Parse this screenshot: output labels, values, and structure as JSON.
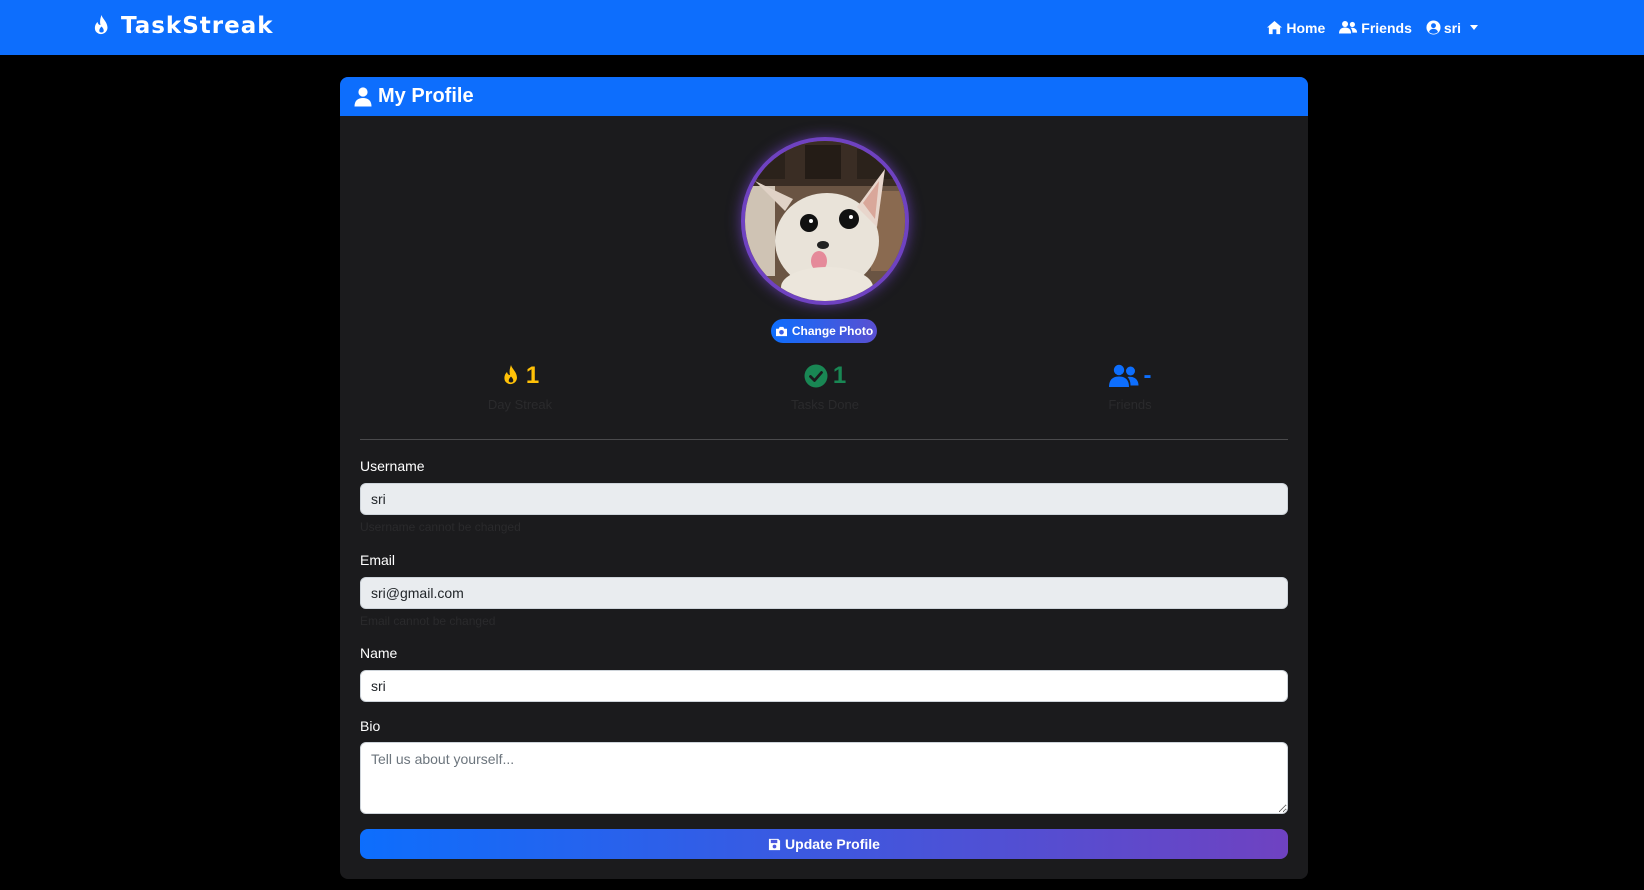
{
  "navbar": {
    "brand": "TaskStreak",
    "home_label": "Home",
    "friends_label": "Friends",
    "user_label": "sri",
    "brand_icon": "fire-icon",
    "home_icon": "house-icon",
    "friends_icon": "users-icon",
    "user_icon": "user-circle-icon"
  },
  "profile": {
    "header_title": "My Profile",
    "header_icon": "user-icon",
    "avatar_alt": "Profile photo of a chihuahua",
    "change_photo_label": "Change Photo",
    "change_photo_icon": "camera-icon"
  },
  "stats": [
    {
      "value": "1",
      "label": "Day Streak",
      "icon": "fire-icon",
      "color": "#ffc107"
    },
    {
      "value": "1",
      "label": "Tasks Done",
      "icon": "check-circle-icon",
      "color": "#198754"
    },
    {
      "value": "-",
      "label": "Friends",
      "icon": "users-icon",
      "color": "#0d6efd"
    }
  ],
  "form": {
    "username_label": "Username",
    "username_value": "sri",
    "username_help": "Username cannot be changed",
    "email_label": "Email",
    "email_value": "sri@gmail.com",
    "email_help": "Email cannot be changed",
    "name_label": "Name",
    "name_value": "sri",
    "bio_label": "Bio",
    "bio_placeholder": "Tell us about yourself...",
    "submit_label": "Update Profile",
    "submit_icon": "floppy-disk-icon"
  },
  "colors": {
    "primary": "#0d6efd",
    "accent_purple": "#6f42c1",
    "card_bg": "#1b1b1d",
    "page_bg": "#000000"
  }
}
